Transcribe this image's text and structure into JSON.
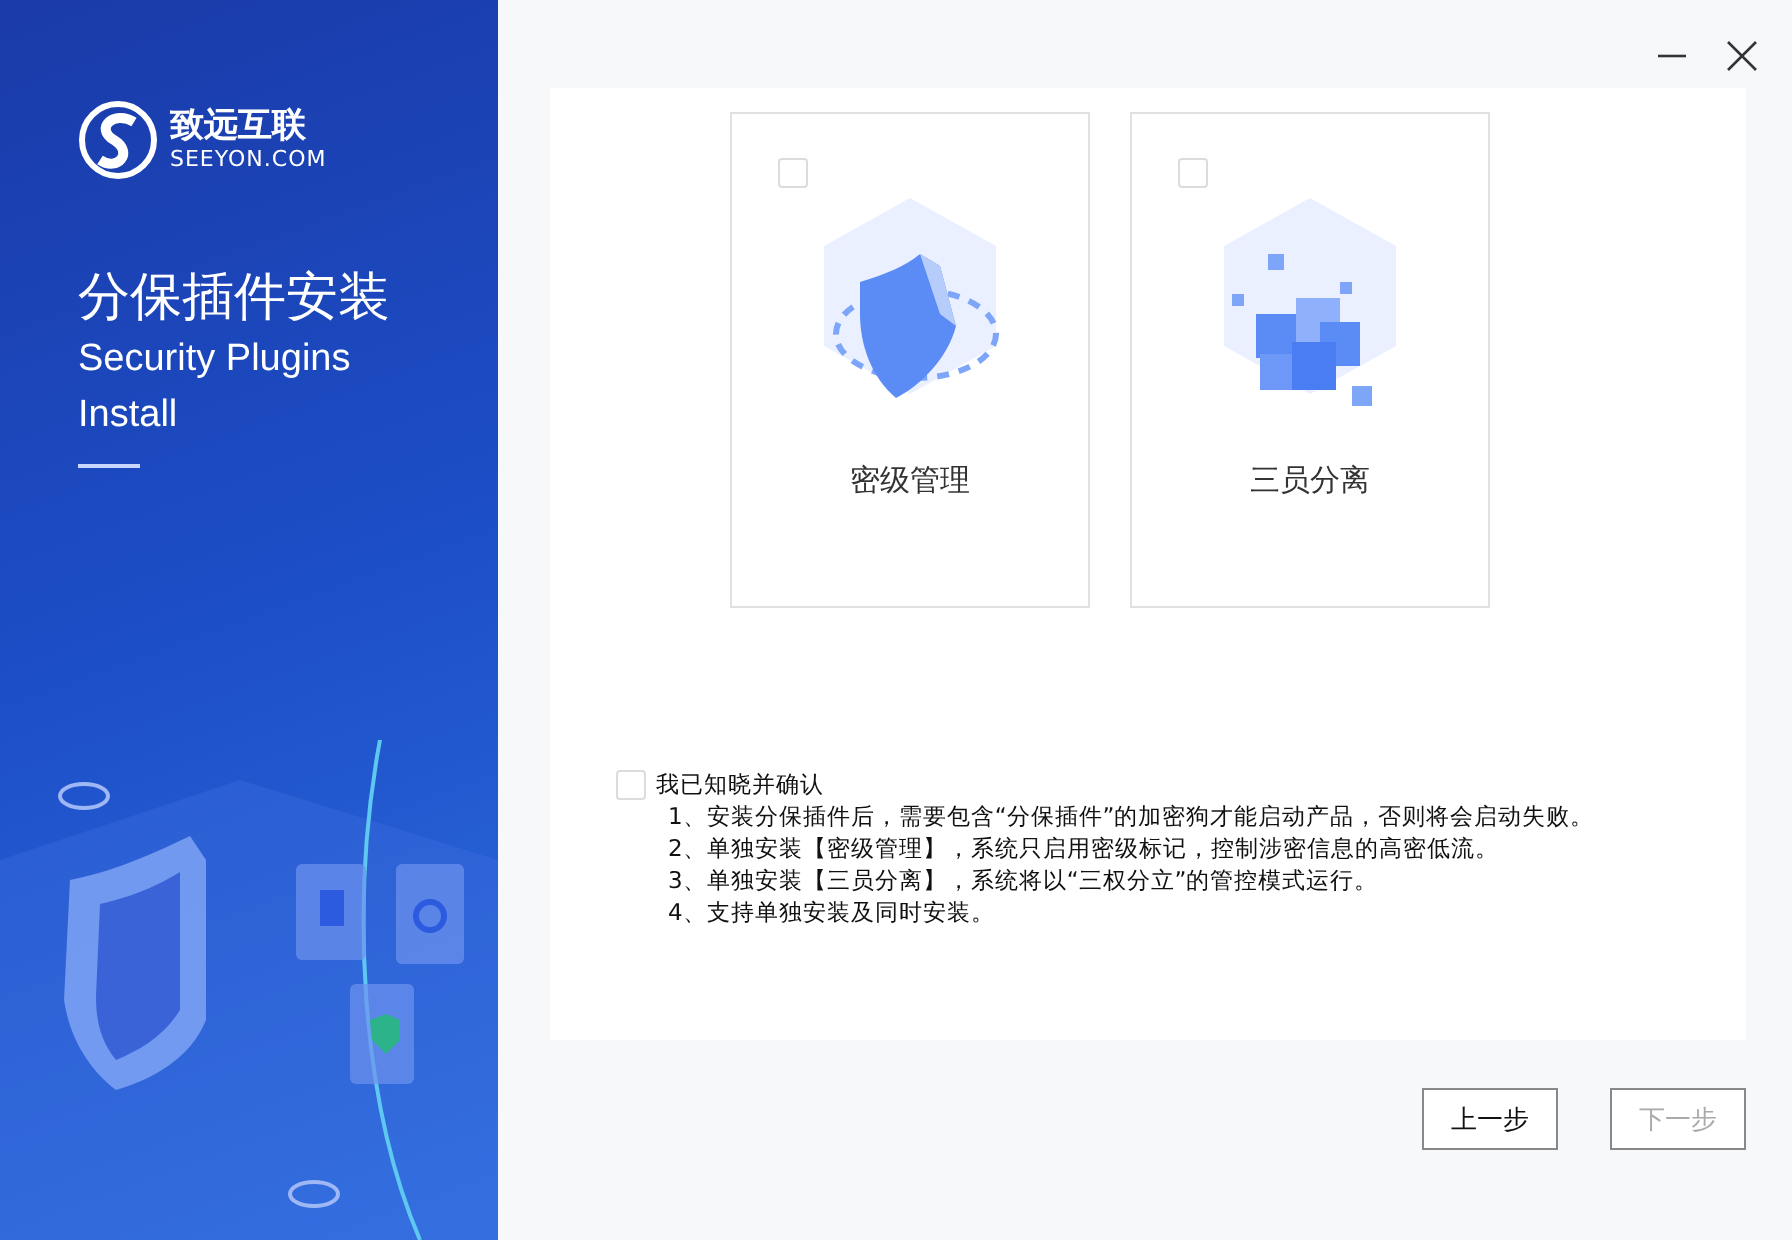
{
  "brand": {
    "name": "致远互联",
    "domain": "SEEYON.COM"
  },
  "heading": {
    "title": "分保插件安装",
    "subtitle_lines": [
      "Security Plugins",
      "Install"
    ]
  },
  "options": [
    {
      "kind": "shield",
      "label": "密级管理",
      "checked": false
    },
    {
      "kind": "cubes",
      "label": "三员分离",
      "checked": false
    }
  ],
  "acknowledge": {
    "label": "我已知晓并确认",
    "checked": false,
    "notes": [
      "1、安装分保插件后，需要包含“分保插件”的加密狗才能启动产品，否则将会启动失败。",
      "2、单独安装【密级管理】，系统只启用密级标记，控制涉密信息的高密低流。",
      "3、单独安装【三员分离】，系统将以“三权分立”的管控模式运行。",
      "4、支持单独安装及同时安装。"
    ]
  },
  "buttons": [
    {
      "label": "上一步",
      "disabled": false
    },
    {
      "label": "下一步",
      "disabled": true
    }
  ]
}
